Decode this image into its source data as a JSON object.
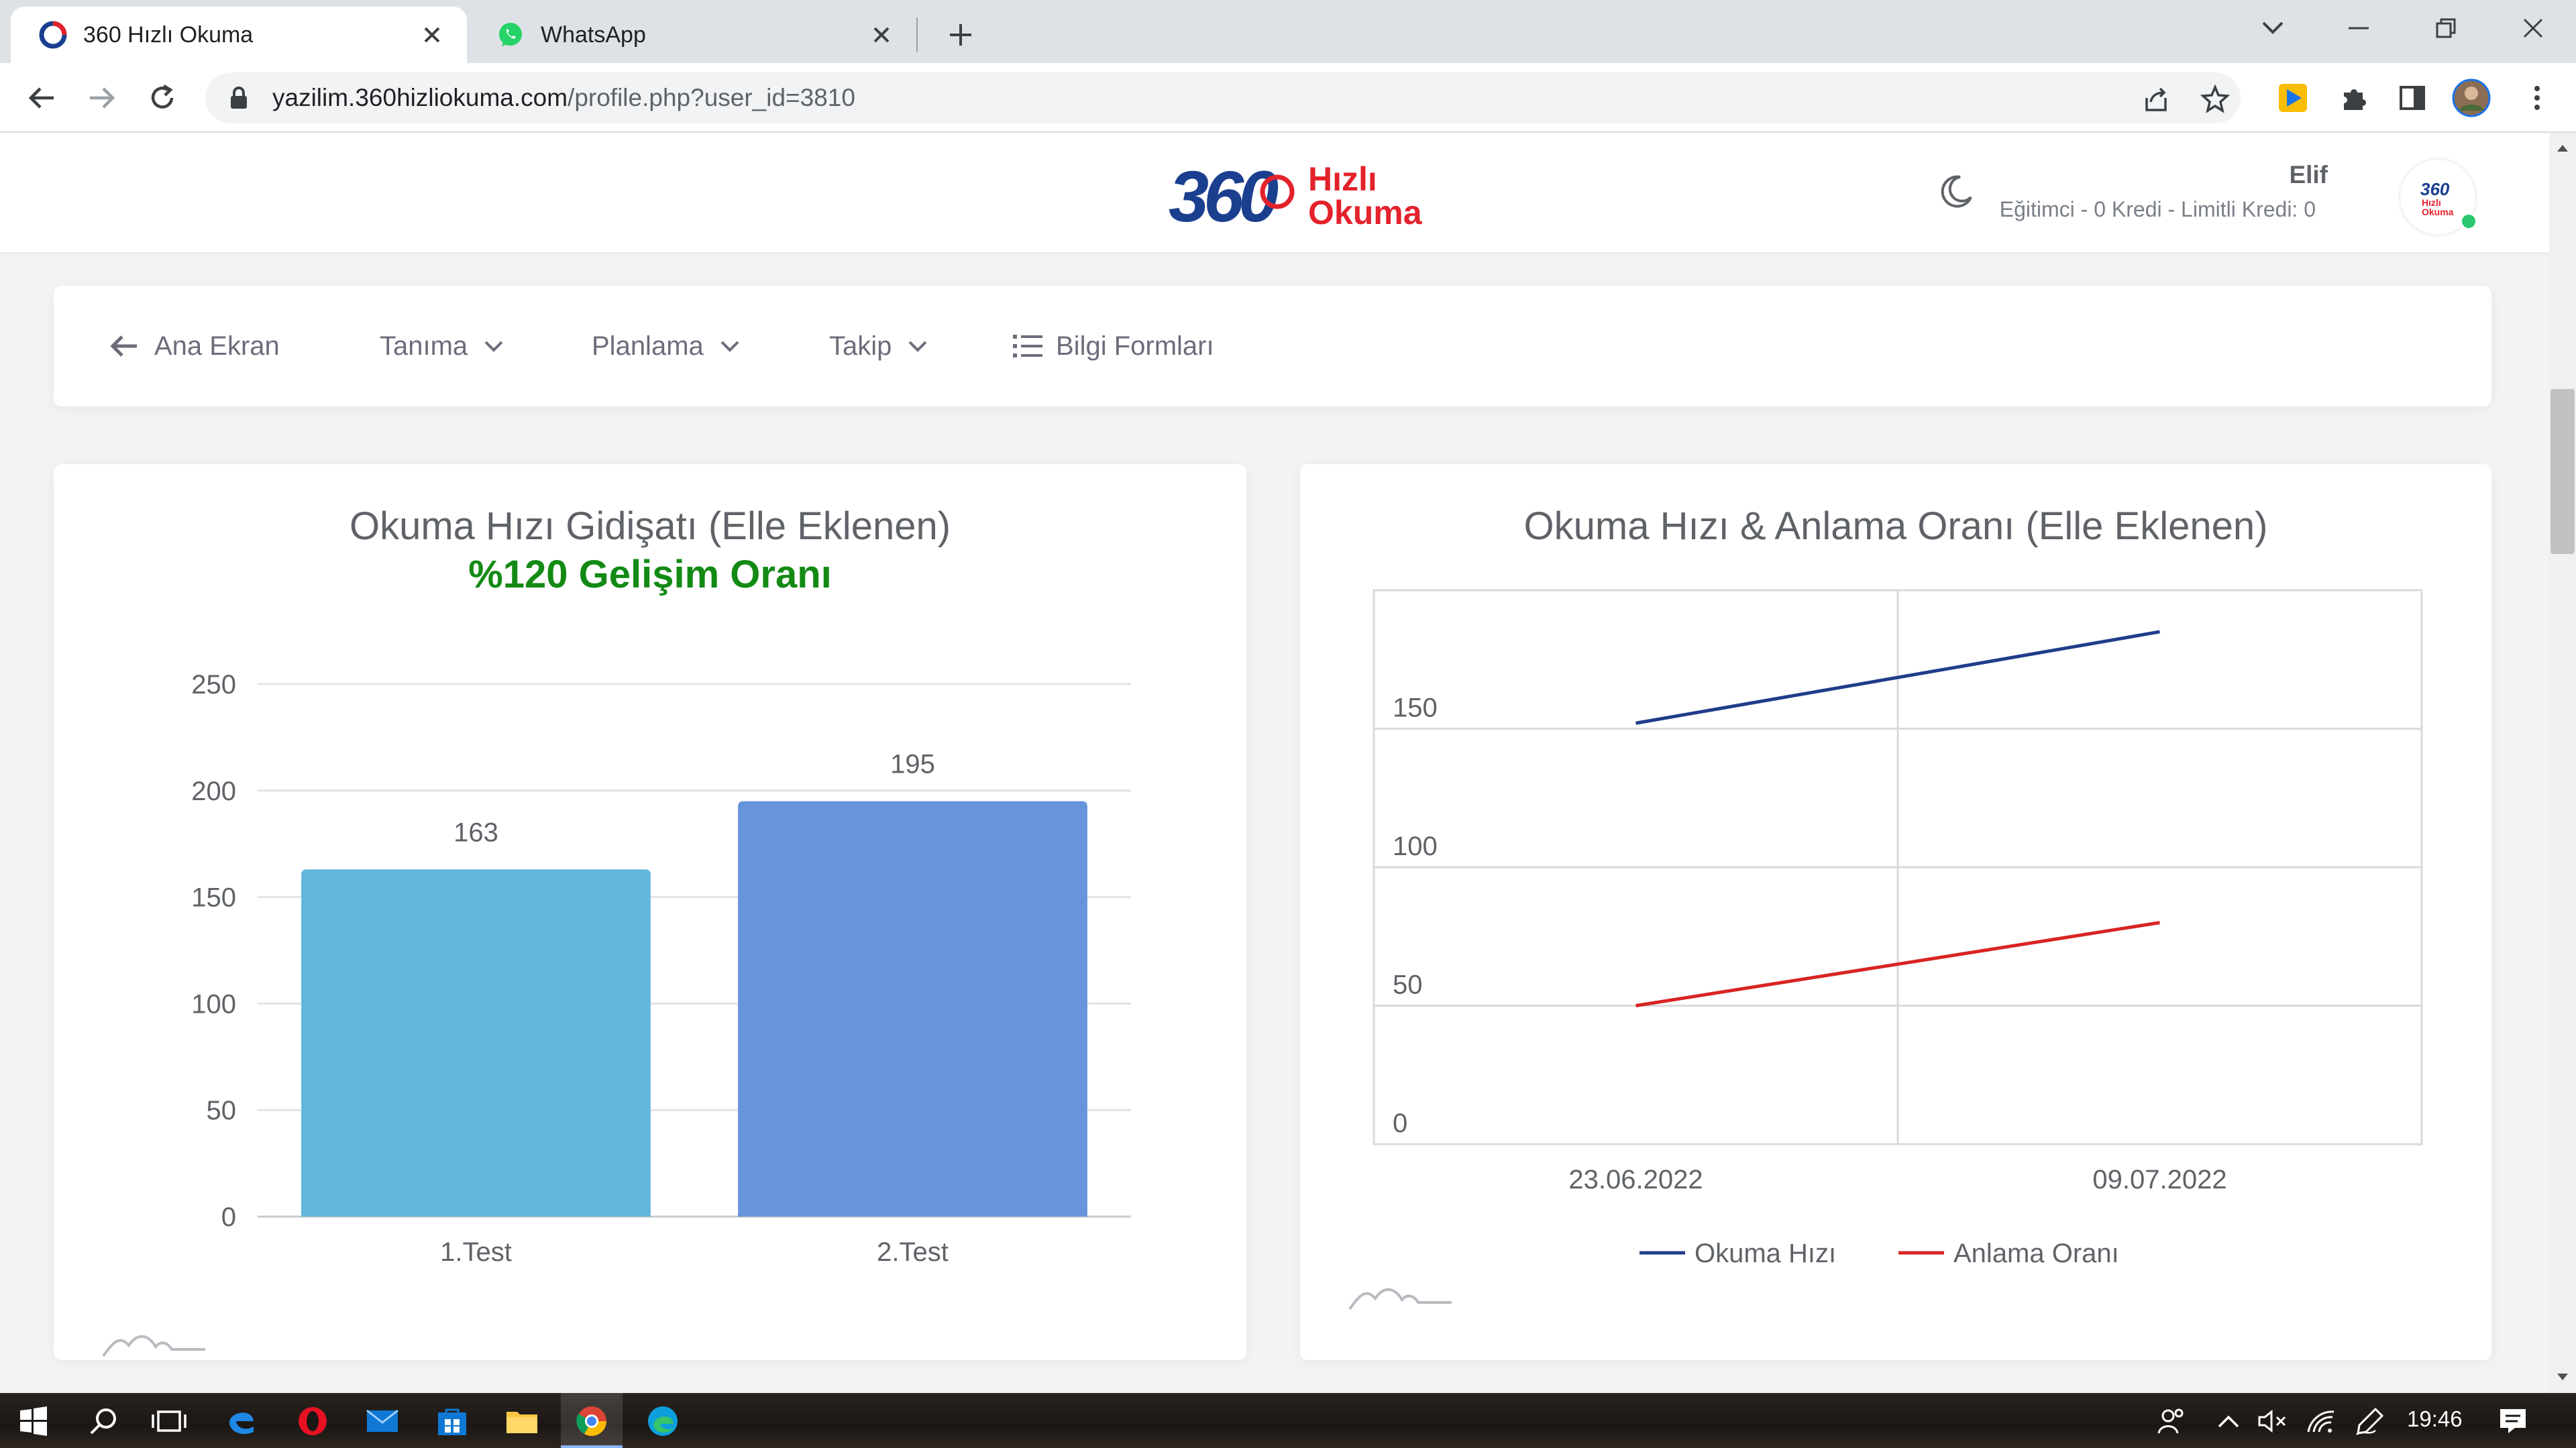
{
  "browser": {
    "tabs": [
      {
        "title": "360 Hızlı Okuma",
        "active": true
      },
      {
        "title": "WhatsApp",
        "active": false
      }
    ],
    "url_host": "yazilim.360hizliokuma.com",
    "url_path": "/profile.php?user_id=3810"
  },
  "header": {
    "logo_text_360": "360",
    "logo_text_line1": "Hızlı",
    "logo_text_line2": "Okuma",
    "user_name": "Elif",
    "user_sub": "Eğitimci - 0 Kredi - Limitli Kredi: 0",
    "avatar_text_1": "360",
    "avatar_text_2": "Hızlı",
    "avatar_text_3": "Okuma"
  },
  "menu": {
    "items": [
      {
        "label": "Ana Ekran",
        "icon": "arrow-left-icon"
      },
      {
        "label": "Tanıma",
        "icon": "chevron-down-icon"
      },
      {
        "label": "Planlama",
        "icon": "chevron-down-icon"
      },
      {
        "label": "Takip",
        "icon": "chevron-down-icon"
      },
      {
        "label": "Bilgi Formları",
        "icon": "list-icon"
      }
    ]
  },
  "taskbar": {
    "clock": "19:46"
  },
  "colors": {
    "accent_green": "#138a14",
    "bar1": "#63b6db",
    "bar2": "#6795dc",
    "line_speed": "#1f3d8a",
    "line_comprehension": "#d82424",
    "brand_blue": "#1b3f8f",
    "brand_red": "#e3222b"
  },
  "chart_data": [
    {
      "type": "bar",
      "title": "Okuma Hızı Gidişatı (Elle Eklenen)",
      "subtitle": "%120 Gelişim Oranı",
      "categories": [
        "1.Test",
        "2.Test"
      ],
      "values": [
        163,
        195
      ],
      "data_labels": [
        "163",
        "195"
      ],
      "ylim": [
        0,
        250
      ],
      "yticks": [
        0,
        50,
        100,
        150,
        200,
        250
      ],
      "grid": true,
      "legend": "none"
    },
    {
      "type": "line",
      "title": "Okuma Hızı & Anlama Oranı (Elle Eklenen)",
      "categories": [
        "23.06.2022",
        "09.07.2022"
      ],
      "series": [
        {
          "name": "Okuma Hızı",
          "values": [
            152,
            185
          ]
        },
        {
          "name": "Anlama Oranı",
          "values": [
            50,
            80
          ]
        }
      ],
      "ylim": [
        0,
        200
      ],
      "yticks": [
        0,
        50,
        100,
        150
      ],
      "grid": true,
      "legend": "bottom"
    }
  ]
}
